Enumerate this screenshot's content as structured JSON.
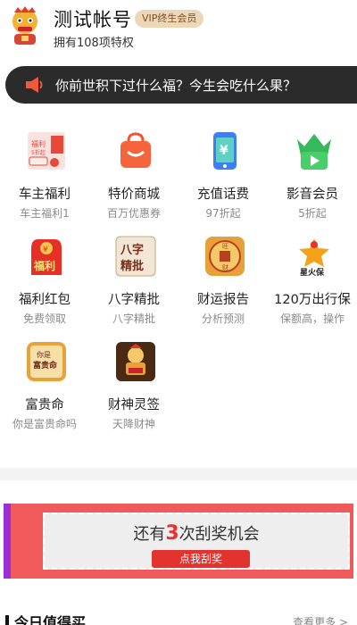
{
  "header": {
    "username": "测试帐号",
    "vip_badge": "VIP终生会员",
    "privilege": "拥有108项特权"
  },
  "notice": {
    "text": "你前世积下过什么福？今生会吃什么果？"
  },
  "services": [
    {
      "title": "车主福利",
      "sub": "车主福利1",
      "icon": "car-benefit-icon",
      "color": "#f26b5b"
    },
    {
      "title": "特价商城",
      "sub": "百万优惠券",
      "icon": "shopping-bag-icon",
      "color": "#f5522f"
    },
    {
      "title": "充值话费",
      "sub": "97折起",
      "icon": "phone-recharge-icon",
      "color": "#3d7ef0"
    },
    {
      "title": "影音会员",
      "sub": "5折起",
      "icon": "video-crown-icon",
      "color": "#33c15a"
    },
    {
      "title": "福利红包",
      "sub": "免费领取",
      "icon": "red-packet-icon",
      "color": "#e62f26"
    },
    {
      "title": "八字精批",
      "sub": "八字精批",
      "icon": "bazi-icon",
      "color": "#c9a676"
    },
    {
      "title": "财运报告",
      "sub": "分析预测",
      "icon": "fortune-coin-icon",
      "color": "#e8a13a"
    },
    {
      "title": "120万出行保",
      "sub": "保额高，操作",
      "icon": "star-insurance-icon",
      "color": "#f08a1d"
    },
    {
      "title": "富贵命",
      "sub": "你是富贵命吗",
      "icon": "wealth-destiny-icon",
      "color": "#d98a24"
    },
    {
      "title": "财神灵签",
      "sub": "天降财神",
      "icon": "fortune-god-icon",
      "color": "#7a4a1e"
    }
  ],
  "scratch": {
    "prefix": "还有",
    "count": "3",
    "suffix": "次刮奖机会",
    "button": "点我刮奖"
  },
  "bottom": {
    "title": "今日值得买",
    "more": "查看更多 >"
  }
}
